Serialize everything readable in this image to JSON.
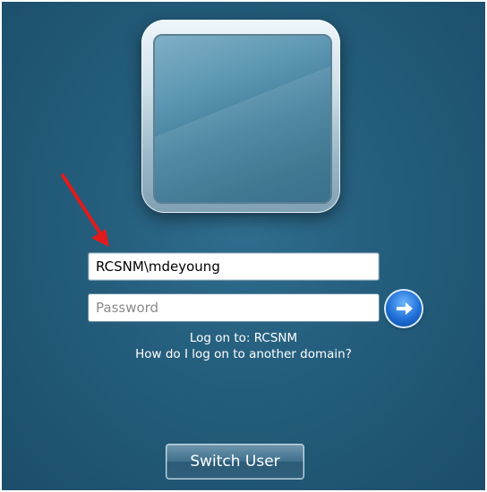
{
  "login": {
    "username_value": "RCSNM\\mdeyoung",
    "password_placeholder": "Password",
    "logon_to_text": "Log on to: RCSNM",
    "other_domain_link": "How do I log on to another domain?",
    "switch_user_label": "Switch User"
  },
  "icons": {
    "user_tile": "user-tile-icon",
    "go_button": "arrow-right-icon",
    "annotation": "red-arrow-annotation"
  },
  "colors": {
    "background": "#245d7c",
    "annotation_arrow": "#e11b1b",
    "go_button": "#1f6fd6"
  }
}
